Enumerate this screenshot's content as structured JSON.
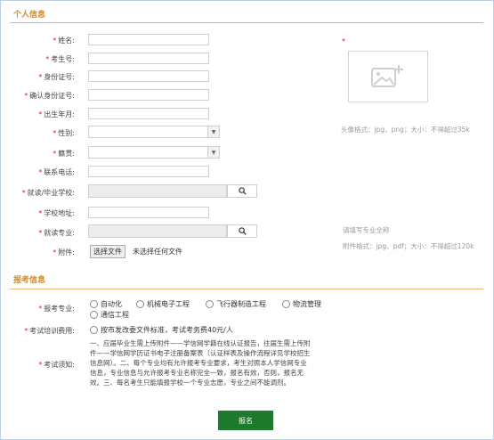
{
  "sections": {
    "personal": "个人信息",
    "apply": "报考信息"
  },
  "fields": {
    "name": "姓名:",
    "exam_no": "考生号:",
    "id_no": "身份证号:",
    "id_confirm": "确认身份证号:",
    "birth": "出生年月:",
    "gender": "性别:",
    "native": "籍贯:",
    "phone": "联系电话:",
    "school": "就读/毕业学校:",
    "school_addr": "学校地址:",
    "major": "就读专业:",
    "attachment": "附件:",
    "apply_major": "报考专业:",
    "fee": "考试培训费用:",
    "notice": "考试须知:"
  },
  "required_mark": "*",
  "photo_hint": "头像格式：jpg、png；大小：不得超过35k",
  "major_hint": "请填写专业全称",
  "attachment_hint": "附件格式：jpg、pdf；大小：不得超过120k",
  "file": {
    "button": "选择文件",
    "status": "未选择任何文件"
  },
  "majors": [
    "自动化",
    "机械电子工程",
    "飞行器制造工程",
    "物流管理",
    "通信工程"
  ],
  "fee_option": "按市发改委文件标准，考试考务费40元/人",
  "notice_text": "一、应届毕业生需上传附件——学信网学籍在线认证报告，往届生需上传附件——学信网学历证书电子注册备案表（认证样表及操作流程详见学校招生信息网）。二、每个专业均有允许报考专业要求，考生对照本人学信网专业信息，专业信息与允许报考专业名称完全一致，报名有效，否则，报名无效。三、每名考生只能填报学校一个专业志愿，专业之间不能调剂。",
  "submit": "报名"
}
